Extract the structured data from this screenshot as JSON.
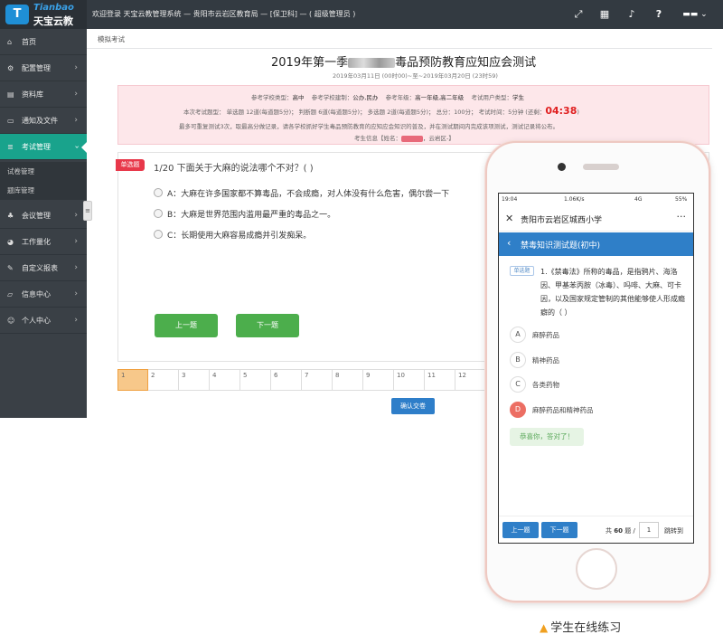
{
  "logo": {
    "badge": "T",
    "en": "Tianbao",
    "cn": "天宝云教"
  },
  "topbar": {
    "welcome": "欢迎登录 天宝云教管理系统 — 贵阳市云岩区教育局 — [保卫科] — ( 超级管理员 )"
  },
  "sidebar": {
    "items": [
      {
        "label": "首页",
        "icon": "home-icon"
      },
      {
        "label": "配置管理",
        "icon": "gear-icon"
      },
      {
        "label": "资料库",
        "icon": "database-icon"
      },
      {
        "label": "通知及文件",
        "icon": "folder-icon"
      },
      {
        "label": "考试管理",
        "icon": "exam-icon"
      },
      {
        "label": "会议管理",
        "icon": "meeting-icon"
      },
      {
        "label": "工作量化",
        "icon": "chart-icon"
      },
      {
        "label": "自定义报表",
        "icon": "report-icon"
      },
      {
        "label": "信息中心",
        "icon": "info-icon"
      },
      {
        "label": "个人中心",
        "icon": "user-icon"
      }
    ],
    "subitems": [
      "试卷管理",
      "题库管理"
    ]
  },
  "breadcrumb": "模拟考试",
  "exam": {
    "title_pre": "2019年第一季",
    "title_post": "毒品预防教育应知应会测试",
    "dates": "2019年03月11日 (00时00)~至~2019年03月20日 (23时59)",
    "line1_a_label": "参考学校类型：",
    "line1_a": "高中",
    "line1_b_label": "参考学校建制：",
    "line1_b": "公办,民办",
    "line1_c_label": "参考年级：",
    "line1_c": "高一年级,高二年级",
    "line1_d_label": "考试用户类型：",
    "line1_d": "学生",
    "line2": "本次考试题型： 单选题 12道(每道题5分)； 判断题 6道(每道题5分)； 多选题 2道(每道题5分)； 总分：100分； 考试时间：5分钟 (还剩：",
    "timer": "04:38",
    "line2_end": ")",
    "line3": "最多可重复测试3次，取最高分做记录，请各学校抓好学生毒品预防教育的应知应会知识的普及，并在测试期间内完成该项测试，测试记录将公布。",
    "line4_pre": "考生信息【姓名：",
    "line4_post": "，云岩区-】"
  },
  "question": {
    "type_badge": "单选题",
    "text": "1/20  下面关于大麻的说法哪个不对？( )",
    "options": [
      "A：大麻在许多国家都不算毒品，不会成瘾，对人体没有什么危害，偶尔尝一下",
      "B：大麻是世界范围内滥用最严重的毒品之一。",
      "C：长期使用大麻容易成瘾并引发痴呆。"
    ],
    "prev": "上一题",
    "next": "下一题"
  },
  "numbers": [
    "1",
    "2",
    "3",
    "4",
    "5",
    "6",
    "7",
    "8",
    "9",
    "10",
    "11",
    "12"
  ],
  "confirm": "确认交卷",
  "mobile": {
    "status_time": "19:04",
    "status_speed": "1.06K/s",
    "status_net": "4G",
    "status_battery": "55%",
    "app_title": "贵阳市云岩区城西小学",
    "menu": "···",
    "section_title": "禁毒知识测试题(初中)",
    "tag": "单选题",
    "question": "1.《禁毒法》所称的毒品，是指鸦片、海洛因、甲基苯丙胺（冰毒）、吗啡、大麻、可卡因，以及国家规定管制的其他能够使人形成瘾癖的（ ）",
    "options": [
      {
        "letter": "A",
        "text": "麻醉药品"
      },
      {
        "letter": "B",
        "text": "精神药品"
      },
      {
        "letter": "C",
        "text": "各类药物"
      },
      {
        "letter": "D",
        "text": "麻醉药品和精神药品"
      }
    ],
    "feedback": "恭喜你，答对了！",
    "prev": "上一题",
    "next": "下一题",
    "total_pre": "共",
    "total": "60",
    "total_post": "题 /",
    "page": "1",
    "jump": "跳转到"
  },
  "caption": "学生在线练习"
}
